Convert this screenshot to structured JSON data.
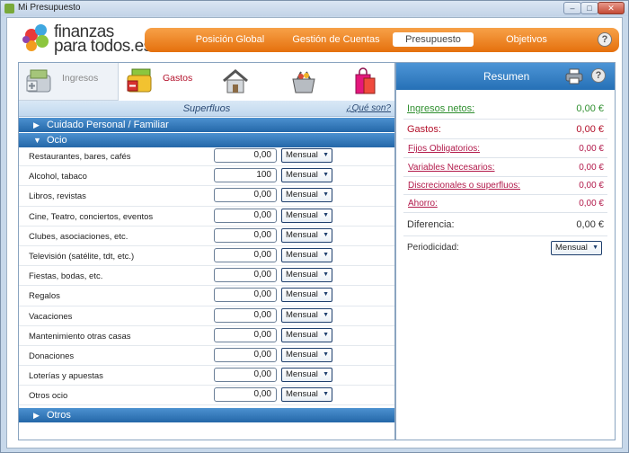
{
  "window": {
    "title": "Mi Presupuesto",
    "min": "–",
    "max": "□",
    "close": "✕"
  },
  "logo": {
    "line1": "finanzas",
    "line2": "para todos.es"
  },
  "nav": {
    "tabs": [
      {
        "label": "Posición Global",
        "active": false
      },
      {
        "label": "Gestión de Cuentas",
        "active": false
      },
      {
        "label": "Presupuesto",
        "active": true
      },
      {
        "label": "Objetivos",
        "active": false
      }
    ],
    "help": "?"
  },
  "categories": {
    "ingresos": "Ingresos",
    "gastos": "Gastos"
  },
  "subheader": {
    "title": "Superfluos",
    "link": "¿Qué son?"
  },
  "groups": {
    "personal": {
      "label": "Cuidado Personal / Familiar",
      "arrow": "▶"
    },
    "ocio": {
      "label": "Ocio",
      "arrow": "▼"
    },
    "otros": {
      "label": "Otros",
      "arrow": "▶"
    }
  },
  "rows": [
    {
      "label": "Restaurantes, bares, cafés",
      "amount": "0,00",
      "period": "Mensual"
    },
    {
      "label": "Alcohol, tabaco",
      "amount": "100",
      "period": "Mensual"
    },
    {
      "label": "Libros, revistas",
      "amount": "0,00",
      "period": "Mensual"
    },
    {
      "label": "Cine, Teatro, conciertos, eventos",
      "amount": "0,00",
      "period": "Mensual"
    },
    {
      "label": "Clubes, asociaciones, etc.",
      "amount": "0,00",
      "period": "Mensual"
    },
    {
      "label": "Televisión (satélite, tdt, etc.)",
      "amount": "0,00",
      "period": "Mensual"
    },
    {
      "label": "Fiestas, bodas, etc.",
      "amount": "0,00",
      "period": "Mensual"
    },
    {
      "label": "Regalos",
      "amount": "0,00",
      "period": "Mensual"
    },
    {
      "label": "Vacaciones",
      "amount": "0,00",
      "period": "Mensual"
    },
    {
      "label": "Mantenimiento otras casas",
      "amount": "0,00",
      "period": "Mensual"
    },
    {
      "label": "Donaciones",
      "amount": "0,00",
      "period": "Mensual"
    },
    {
      "label": "Loterías y apuestas",
      "amount": "0,00",
      "period": "Mensual"
    },
    {
      "label": "Otros ocio",
      "amount": "0,00",
      "period": "Mensual"
    }
  ],
  "summary": {
    "title": "Resumen",
    "help": "?",
    "ingresos_label": "Ingresos netos:",
    "ingresos_value": "0,00 €",
    "gastos_label": "Gastos:",
    "gastos_value": "0,00 €",
    "fijos_label": "Fijos Obligatorios:",
    "fijos_value": "0,00 €",
    "variables_label": "Variables Necesarios:",
    "variables_value": "0,00 €",
    "discrecionales_label": "Discrecionales o superfluos:",
    "discrecionales_value": "0,00 €",
    "ahorro_label": "Ahorro:",
    "ahorro_value": "0,00 €",
    "diferencia_label": "Diferencia:",
    "diferencia_value": "0,00 €",
    "periodicidad_label": "Periodicidad:",
    "periodicidad_value": "Mensual"
  },
  "colors": {
    "nav_orange": "#ef8a2a",
    "blue_header": "#2d73b8",
    "green": "#2f8f2f",
    "red": "#b3102a",
    "magenta": "#b2194a"
  }
}
